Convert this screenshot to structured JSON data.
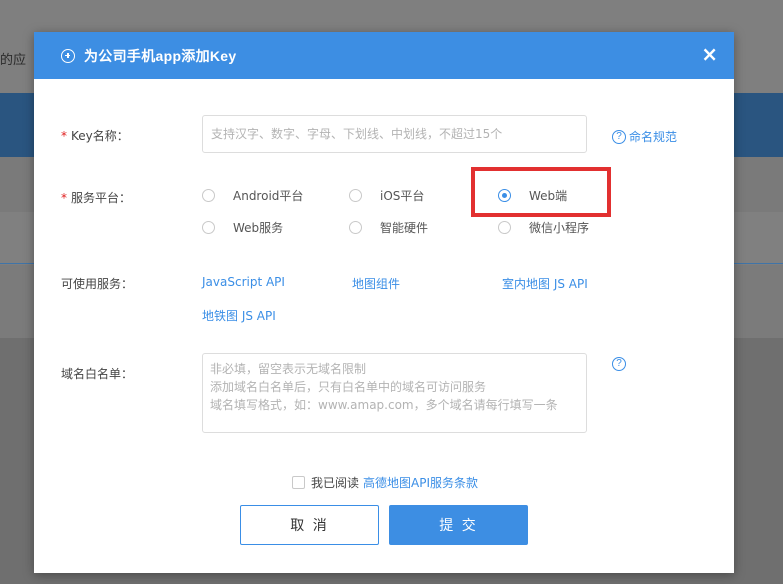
{
  "background": {
    "partial_text": "的应"
  },
  "modal": {
    "title": "为公司手机app添加Key",
    "close": "×"
  },
  "form": {
    "key_name": {
      "label": "Key名称：",
      "placeholder": "支持汉字、数字、字母、下划线、中划线，不超过15个",
      "value": "",
      "help_text": "命名规范"
    },
    "platform": {
      "label": "服务平台：",
      "options": [
        "Android平台",
        "iOS平台",
        "Web端",
        "Web服务",
        "智能硬件",
        "微信小程序"
      ],
      "selected": "Web端"
    },
    "services": {
      "label": "可使用服务：",
      "items": [
        "JavaScript API",
        "地图组件",
        "室内地图 JS API",
        "地铁图 JS API"
      ]
    },
    "whitelist": {
      "label": "域名白名单：",
      "placeholder": "非必填，留空表示无域名限制\n添加域名白名单后，只有白名单中的域名可访问服务\n域名填写格式，如：www.amap.com，多个域名请每行填写一条",
      "value": ""
    },
    "agreement": {
      "text": "我已阅读",
      "link": "高德地图API服务条款",
      "checked": false
    },
    "buttons": {
      "cancel": "取 消",
      "submit": "提 交"
    }
  },
  "colors": {
    "primary": "#3d8ee3",
    "required": "#e02020",
    "highlight": "#e23030"
  },
  "icons": {
    "header": "plus-circle-icon",
    "close": "close-icon",
    "help": "question-circle-icon"
  }
}
